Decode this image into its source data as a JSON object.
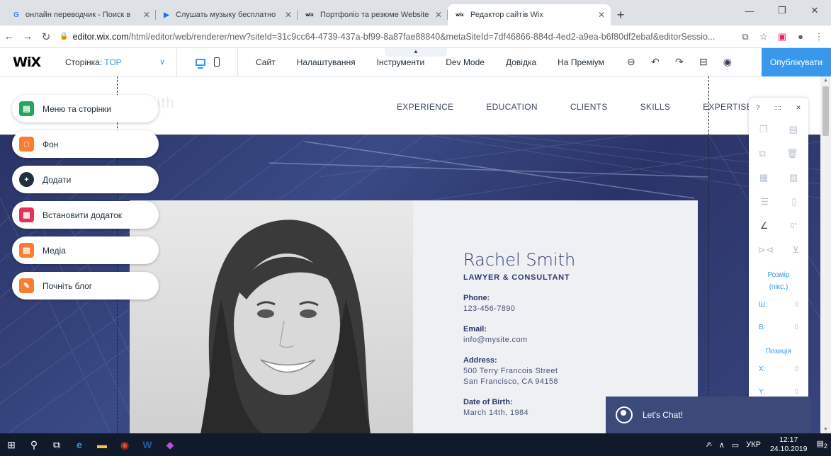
{
  "browser": {
    "tabs": [
      {
        "icon": "G",
        "icon_color": "#4285f4",
        "title": "онлайн переводчик - Поиск в ",
        "active": false
      },
      {
        "icon": "▶",
        "icon_color": "#1a73e8",
        "title": "Слушать музыку бесплатно",
        "active": false
      },
      {
        "icon": "wix",
        "icon_color": "#000000",
        "title": "Портфоліо та резюме Website ",
        "active": false
      },
      {
        "icon": "wix",
        "icon_color": "#000000",
        "title": "Редактор сайтів Wix",
        "active": true
      }
    ],
    "url_domain": "editor.wix.com",
    "url_rest": "/html/editor/web/renderer/new?siteId=31c9cc64-4739-437a-bf99-8a87fae88840&metaSiteId=7df46866-884d-4ed2-a9ea-b6f80df2ebaf&editorSessio..."
  },
  "wix": {
    "logo": "WiX",
    "page_label": "Сторінка:",
    "page_value": "TOP",
    "menu": [
      "Сайт",
      "Налаштування",
      "Інструменти",
      "Dev Mode",
      "Довідка",
      "На Преміум"
    ],
    "publish": "Опублікувати",
    "accent": "#3899ec"
  },
  "left_panel": [
    {
      "label": "Меню та сторінки",
      "icon": "pages-icon",
      "color": "#25a55f"
    },
    {
      "label": "Фон",
      "icon": "background-icon",
      "color": "#fb7d33"
    },
    {
      "label": "Додати",
      "icon": "add-icon",
      "color": "#20303c"
    },
    {
      "label": "Встановити додаток",
      "icon": "app-market-icon",
      "color": "#e6315b"
    },
    {
      "label": "Медіа",
      "icon": "media-icon",
      "color": "#fb7d33"
    },
    {
      "label": "Почніть блог",
      "icon": "blog-icon",
      "color": "#fb7d33"
    }
  ],
  "site": {
    "nav": [
      "EXPERIENCE",
      "EDUCATION",
      "CLIENTS",
      "SKILLS",
      "EXPERTISE"
    ],
    "ghost_name": "Rachel Smith",
    "name": "Rachel Smith",
    "title": "LAWYER & CONSULTANT",
    "fields": [
      {
        "label": "Phone:",
        "value": [
          "123-456-7890"
        ]
      },
      {
        "label": "Email:",
        "value": [
          "info@mysite.com"
        ]
      },
      {
        "label": "Address:",
        "value": [
          "500 Terry Francois Street",
          "San Francisco, CA 94158"
        ]
      },
      {
        "label": "Date of Birth:",
        "value": [
          "March 14th, 1984"
        ]
      }
    ],
    "chat": "Let's Chat!"
  },
  "right_toolbar": {
    "help": "?",
    "rotation": "0°",
    "size_label_1": "Розмір",
    "size_label_2": "(пікс.)",
    "width_label": "Ш:",
    "height_label": "В:",
    "position_label": "Позиція",
    "x_label": "X:",
    "y_label": "Y:",
    "width": "0",
    "height": "0",
    "x": "0",
    "y": "0"
  },
  "taskbar": {
    "lang": "УКР",
    "time": "12:17",
    "date": "24.10.2019",
    "notifications": "2"
  }
}
